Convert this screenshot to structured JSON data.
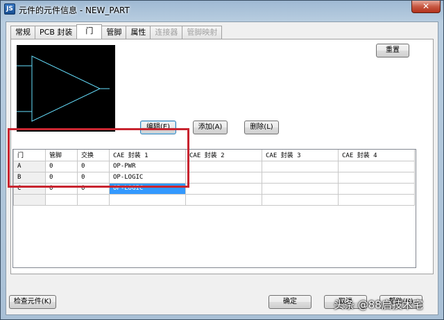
{
  "titlebar": {
    "app_icon": "JS",
    "title": "元件的元件信息 - NEW_PART",
    "close_icon": "✕"
  },
  "tabs": [
    {
      "label": "常规",
      "state": "normal"
    },
    {
      "label": "PCB 封装",
      "state": "normal"
    },
    {
      "label": "门",
      "state": "active"
    },
    {
      "label": "管脚",
      "state": "normal"
    },
    {
      "label": "属性",
      "state": "normal"
    },
    {
      "label": "连接器",
      "state": "disabled"
    },
    {
      "label": "管脚映射",
      "state": "disabled"
    }
  ],
  "buttons": {
    "reset": "重置",
    "edit": "编辑(E)",
    "add": "添加(A)",
    "delete": "删除(L)",
    "check": "检查元件(K)",
    "ok": "确定",
    "cancel": "取消",
    "help": "帮助(H)"
  },
  "grid": {
    "columns": [
      "门",
      "管脚",
      "交换",
      "CAE 封装 1",
      "CAE 封装 2",
      "CAE 封装 3",
      "CAE 封装 4"
    ],
    "rows": [
      [
        "A",
        "0",
        "0",
        "OP-PWR",
        "",
        "",
        ""
      ],
      [
        "B",
        "0",
        "0",
        "OP-LOGIC",
        "",
        "",
        ""
      ],
      [
        "C",
        "0",
        "0",
        "OP-LOGIC",
        "",
        "",
        ""
      ]
    ]
  },
  "watermark": "头条 @88启技术宅",
  "colors": {
    "highlight": "#c8242f",
    "selection": "#3399ff",
    "preview_line": "#66e0ff"
  }
}
